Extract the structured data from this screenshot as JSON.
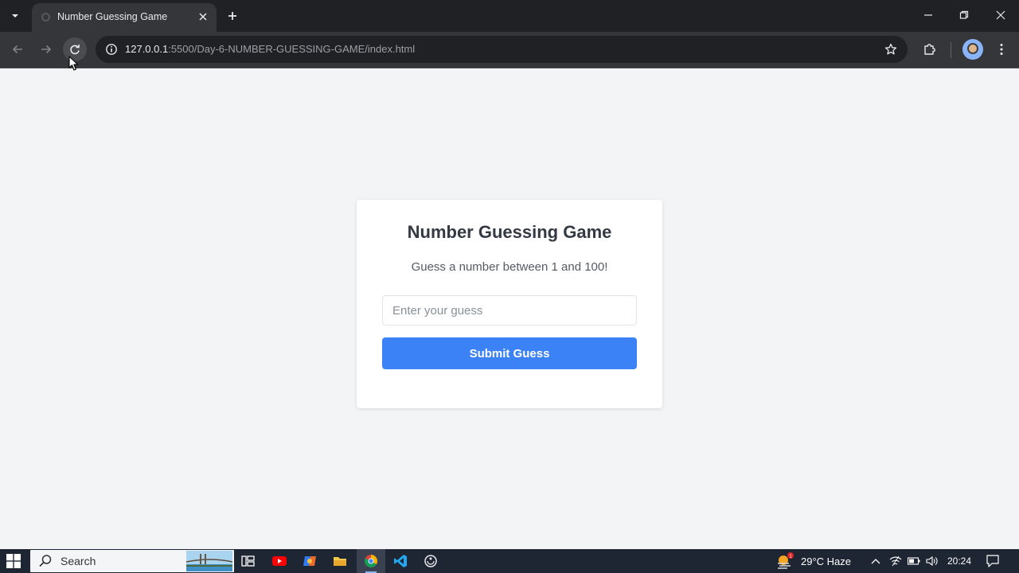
{
  "browser": {
    "tab_title": "Number Guessing Game",
    "url_host": "127.0.0.1",
    "url_path": ":5500/Day-6-NUMBER-GUESSING-GAME/index.html"
  },
  "game": {
    "title": "Number Guessing Game",
    "subtitle": "Guess a number between 1 and 100!",
    "input_placeholder": "Enter your guess",
    "input_value": "",
    "submit_label": "Submit Guess",
    "accent_color": "#3b82f6"
  },
  "taskbar": {
    "search_label": "Search",
    "weather": "29°C  Haze",
    "weather_badge": "1",
    "clock": "20:24"
  },
  "icons": {
    "tab_search": "chevron-down-icon",
    "tab_close": "close-icon",
    "new_tab": "plus-icon",
    "back": "arrow-left-icon",
    "forward": "arrow-right-icon",
    "reload": "reload-icon",
    "site_info": "info-icon",
    "bookmark": "star-icon",
    "extensions": "puzzle-icon",
    "menu": "kebab-menu-icon"
  }
}
